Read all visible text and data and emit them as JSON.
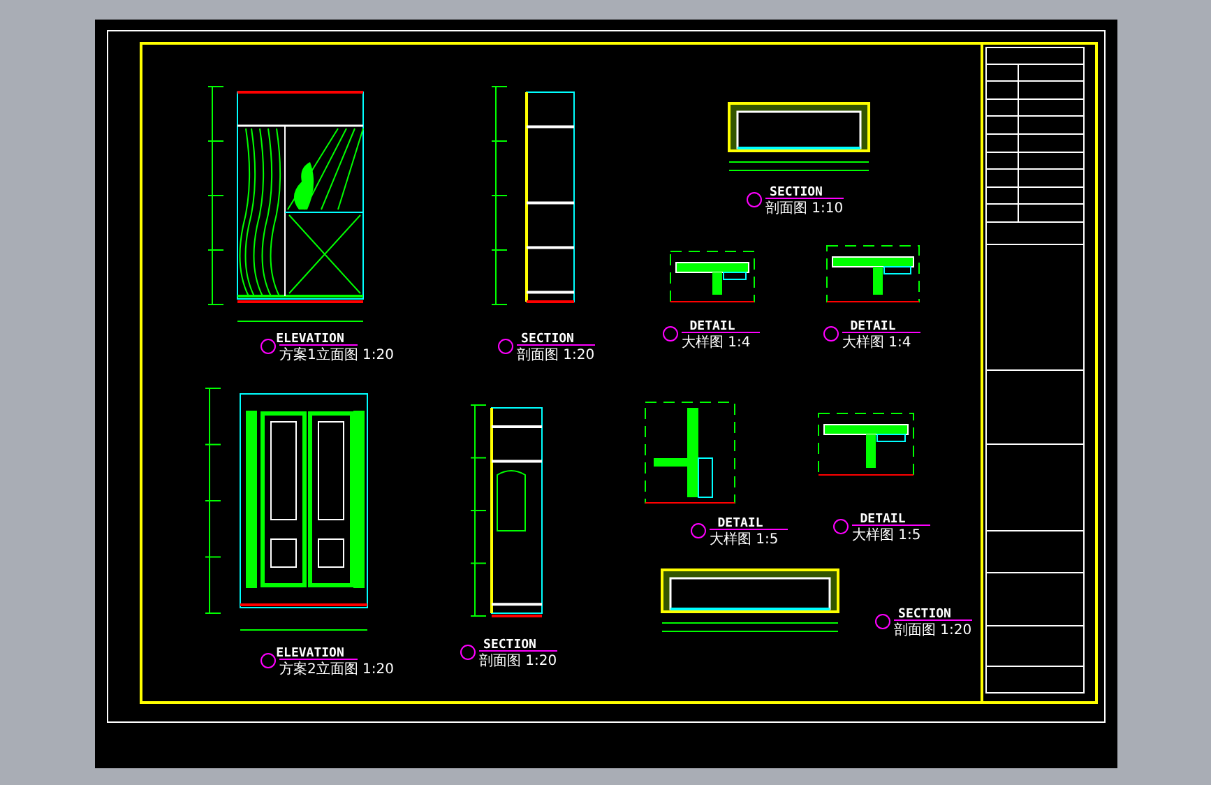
{
  "views": [
    {
      "kind": "elevation-glass",
      "heading": "ELEVATION",
      "title": "方案1立面图 1:20"
    },
    {
      "kind": "section-tall",
      "heading": "SECTION",
      "title": "剖面图 1:20"
    },
    {
      "kind": "plan",
      "heading": "SECTION",
      "title": "剖面图 1:10"
    },
    {
      "kind": "detail-a",
      "heading": "DETAIL",
      "title": "大样图 1:4"
    },
    {
      "kind": "detail-b",
      "heading": "DETAIL",
      "title": "大样图 1:4"
    },
    {
      "kind": "elevation-doors",
      "heading": "ELEVATION",
      "title": "方案2立面图 1:20"
    },
    {
      "kind": "section-wardrobe",
      "heading": "SECTION",
      "title": "剖面图 1:20"
    },
    {
      "kind": "detail-c",
      "heading": "DETAIL",
      "title": "大样图 1:5"
    },
    {
      "kind": "detail-d",
      "heading": "DETAIL",
      "title": "大样图 1:5"
    },
    {
      "kind": "plan-wide",
      "heading": "SECTION",
      "title": "剖面图 1:20"
    }
  ]
}
